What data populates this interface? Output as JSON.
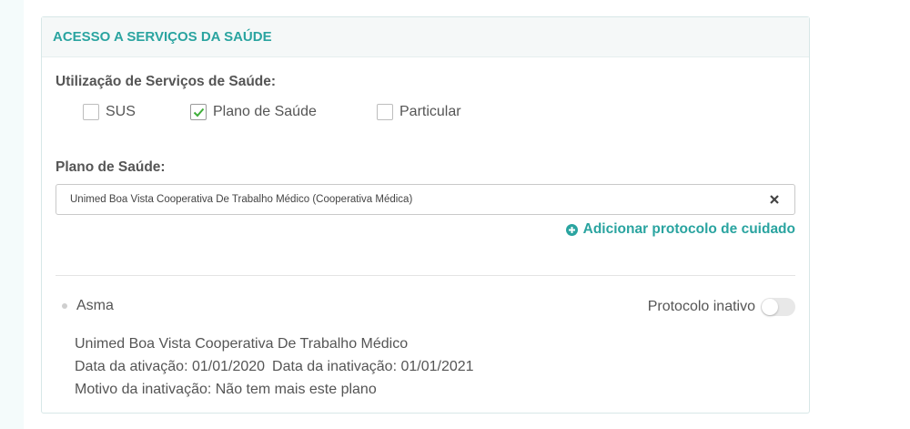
{
  "panel": {
    "title": "ACESSO A SERVIÇOS DA SAÚDE"
  },
  "services": {
    "label": "Utilização de Serviços de Saúde:",
    "options": [
      {
        "label": "SUS",
        "checked": false
      },
      {
        "label": "Plano de Saúde",
        "checked": true
      },
      {
        "label": "Particular",
        "checked": false
      }
    ]
  },
  "health_plan": {
    "label": "Plano de Saúde:",
    "selected_value": "Unimed Boa Vista Cooperativa De Trabalho Médico (Cooperativa Médica)",
    "clear_icon": "close-icon"
  },
  "add_protocol": {
    "label": "Adicionar protocolo de cuidado",
    "icon": "plus-circle-icon"
  },
  "protocol": {
    "name": "Asma",
    "toggle_label": "Protocolo inativo",
    "toggle_on": false,
    "plan_name": "Unimed Boa Vista Cooperativa De Trabalho Médico",
    "activation": "Data da ativação: 01/01/2020",
    "inactivation": "Data da inativação: 01/01/2021",
    "reason": "Motivo da inativação: Não tem mais este plano"
  },
  "colors": {
    "accent": "#2aa4a0",
    "check": "#3fae3a"
  }
}
